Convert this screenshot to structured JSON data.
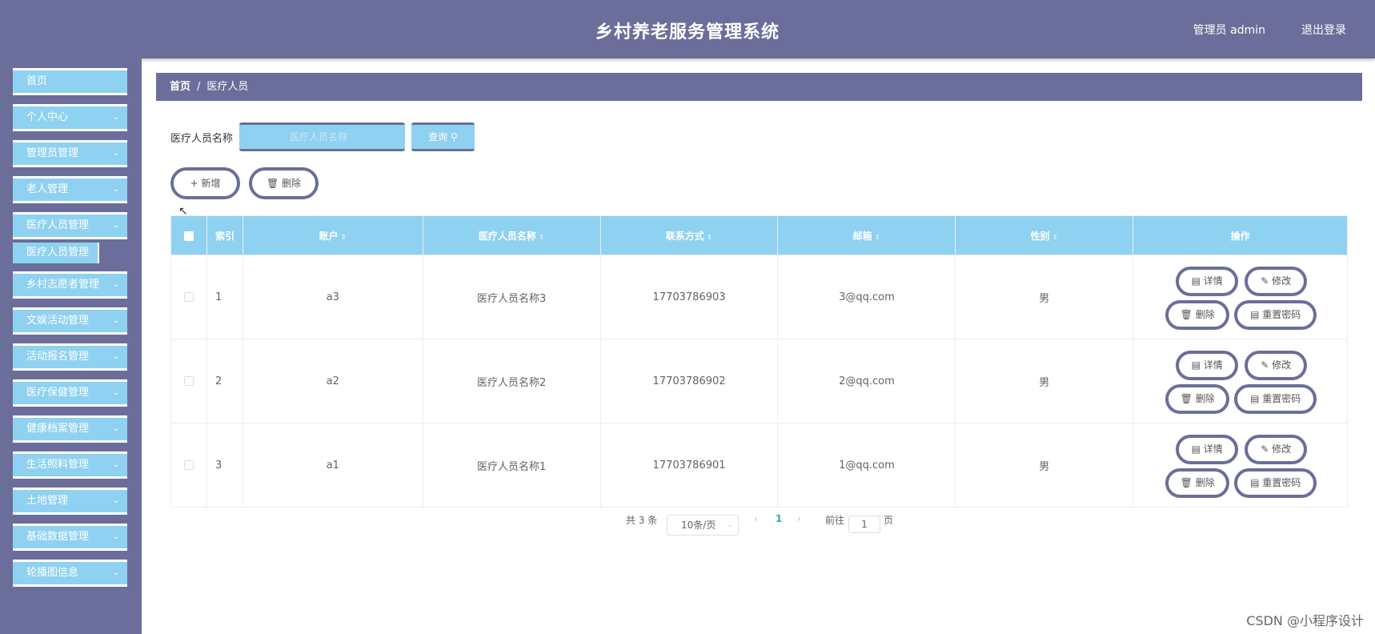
{
  "header": {
    "title": "乡村养老服务管理系统",
    "user": "管理员 admin",
    "logout": "退出登录"
  },
  "sidebar": {
    "home": "首页",
    "items": [
      {
        "label": "个人中心"
      },
      {
        "label": "管理员管理"
      },
      {
        "label": "老人管理"
      },
      {
        "label": "医疗人员管理"
      },
      {
        "label": "乡村志愿者管理"
      },
      {
        "label": "文娱活动管理"
      },
      {
        "label": "活动报名管理"
      },
      {
        "label": "医疗保健管理"
      },
      {
        "label": "健康档案管理"
      },
      {
        "label": "生活照料管理"
      },
      {
        "label": "土地管理"
      },
      {
        "label": "基础数据管理"
      },
      {
        "label": "轮播图信息"
      }
    ],
    "active_sub": "医疗人员管理"
  },
  "breadcrumb": {
    "home": "首页",
    "sep": "/",
    "current": "医疗人员"
  },
  "search": {
    "label": "医疗人员名称",
    "placeholder": "医疗人员名称",
    "query": "查询"
  },
  "actions": {
    "add": "新增",
    "delete": "删除"
  },
  "table": {
    "headers": [
      "索引",
      "账户",
      "医疗人员名称",
      "联系方式",
      "邮箱",
      "性别",
      "操作"
    ],
    "rows": [
      {
        "index": "1",
        "account": "a3",
        "name": "医疗人员名称3",
        "phone": "17703786903",
        "email": "3@qq.com",
        "gender": "男"
      },
      {
        "index": "2",
        "account": "a2",
        "name": "医疗人员名称2",
        "phone": "17703786902",
        "email": "2@qq.com",
        "gender": "男"
      },
      {
        "index": "3",
        "account": "a1",
        "name": "医疗人员名称1",
        "phone": "17703786901",
        "email": "1@qq.com",
        "gender": "男"
      }
    ],
    "ops": {
      "detail": "详情",
      "edit": "修改",
      "delete": "删除",
      "reset": "重置密码"
    }
  },
  "pagination": {
    "total": "共 3 条",
    "size": "10条/页",
    "current": "1",
    "goto": "前往",
    "page_input": "1",
    "page_unit": "页"
  },
  "watermark": "CSDN @小程序设计",
  "colors": {
    "primary": "#6b6e9a",
    "accent": "#8fd1f1"
  }
}
